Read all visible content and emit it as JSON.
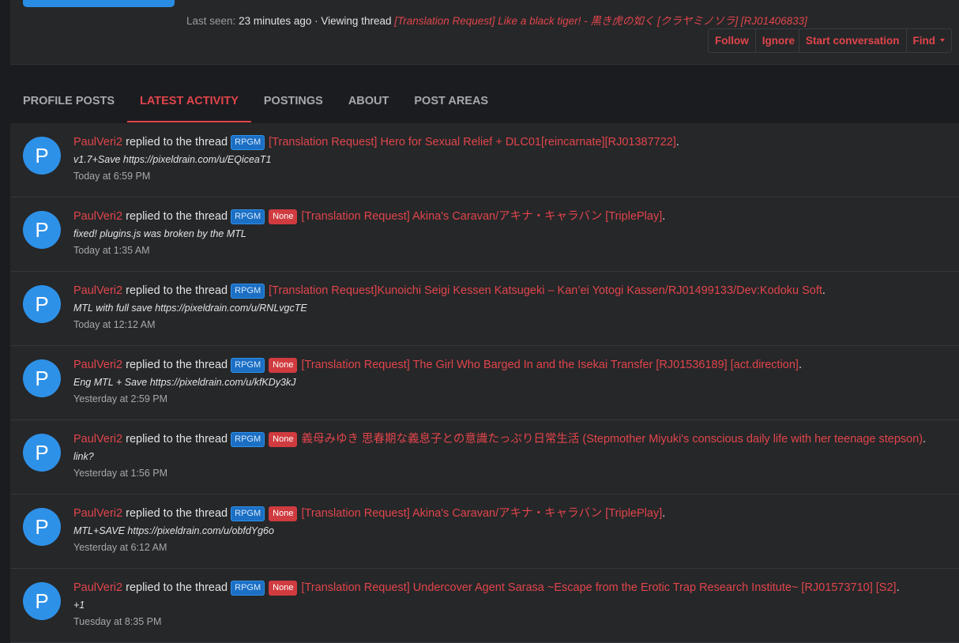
{
  "colors": {
    "background": "#1b1c1f",
    "panel": "#262729",
    "accent": "#e0454b",
    "avatar": "#2e91e8",
    "prefix_rpgm": "#1b6fc4",
    "prefix_none": "#d03b3f"
  },
  "header": {
    "last_seen_label": "Last seen:",
    "last_seen_value": "23 minutes ago",
    "separator": "·",
    "viewing_label": "Viewing thread",
    "viewing_thread": "[Translation Request] Like a black tiger! - 黒き虎の如く [クラヤミノソラ] [RJ01406833]",
    "buttons": {
      "follow": "Follow",
      "ignore": "Ignore",
      "start_conversation": "Start conversation",
      "find": "Find"
    }
  },
  "tabs": [
    {
      "label": "PROFILE POSTS",
      "active": false
    },
    {
      "label": "LATEST ACTIVITY",
      "active": true
    },
    {
      "label": "POSTINGS",
      "active": false
    },
    {
      "label": "ABOUT",
      "active": false
    },
    {
      "label": "POST AREAS",
      "active": false
    }
  ],
  "activity": [
    {
      "avatar_letter": "P",
      "user": "PaulVeri2",
      "action": "replied to the thread",
      "prefixes": [
        "RPGM"
      ],
      "thread": "[Translation Request] Hero for Sexual Relief + DLC01[reincarnate][RJ01387722]",
      "snippet": "v1.7+Save https://pixeldrain.com/u/EQiceaT1",
      "time": "Today at 6:59 PM"
    },
    {
      "avatar_letter": "P",
      "user": "PaulVeri2",
      "action": "replied to the thread",
      "prefixes": [
        "RPGM",
        "None"
      ],
      "thread": "[Translation Request] Akina's Caravan/アキナ・キャラバン [TriplePlay]",
      "snippet": "fixed! plugins.js was broken by the MTL",
      "time": "Today at 1:35 AM"
    },
    {
      "avatar_letter": "P",
      "user": "PaulVeri2",
      "action": "replied to the thread",
      "prefixes": [
        "RPGM"
      ],
      "thread": "[Translation Request]Kunoichi Seigi Kessen Katsugeki – Kan’ei Yotogi Kassen/RJ01499133/Dev:Kodoku Soft",
      "snippet": "MTL with full save https://pixeldrain.com/u/RNLvgcTE",
      "time": "Today at 12:12 AM"
    },
    {
      "avatar_letter": "P",
      "user": "PaulVeri2",
      "action": "replied to the thread",
      "prefixes": [
        "RPGM",
        "None"
      ],
      "thread": "[Translation Request] The Girl Who Barged In and the Isekai Transfer [RJ01536189] [act.direction]",
      "snippet": "Eng MTL + Save https://pixeldrain.com/u/kfKDy3kJ",
      "time": "Yesterday at 2:59 PM"
    },
    {
      "avatar_letter": "P",
      "user": "PaulVeri2",
      "action": "replied to the thread",
      "prefixes": [
        "RPGM",
        "None"
      ],
      "thread": "義母みゆき 思春期な義息子との意識たっぷり日常生活 (Stepmother Miyuki's conscious daily life with her teenage stepson)",
      "snippet": "link?",
      "time": "Yesterday at 1:56 PM"
    },
    {
      "avatar_letter": "P",
      "user": "PaulVeri2",
      "action": "replied to the thread",
      "prefixes": [
        "RPGM",
        "None"
      ],
      "thread": "[Translation Request] Akina's Caravan/アキナ・キャラバン [TriplePlay]",
      "snippet": "MTL+SAVE https://pixeldrain.com/u/obfdYg6o",
      "time": "Yesterday at 6:12 AM"
    },
    {
      "avatar_letter": "P",
      "user": "PaulVeri2",
      "action": "replied to the thread",
      "prefixes": [
        "RPGM",
        "None"
      ],
      "thread": "[Translation Request] Undercover Agent Sarasa ~Escape from the Erotic Trap Research Institute~ [RJ01573710] [S2]",
      "snippet": "+1",
      "time": "Tuesday at 8:35 PM"
    }
  ]
}
